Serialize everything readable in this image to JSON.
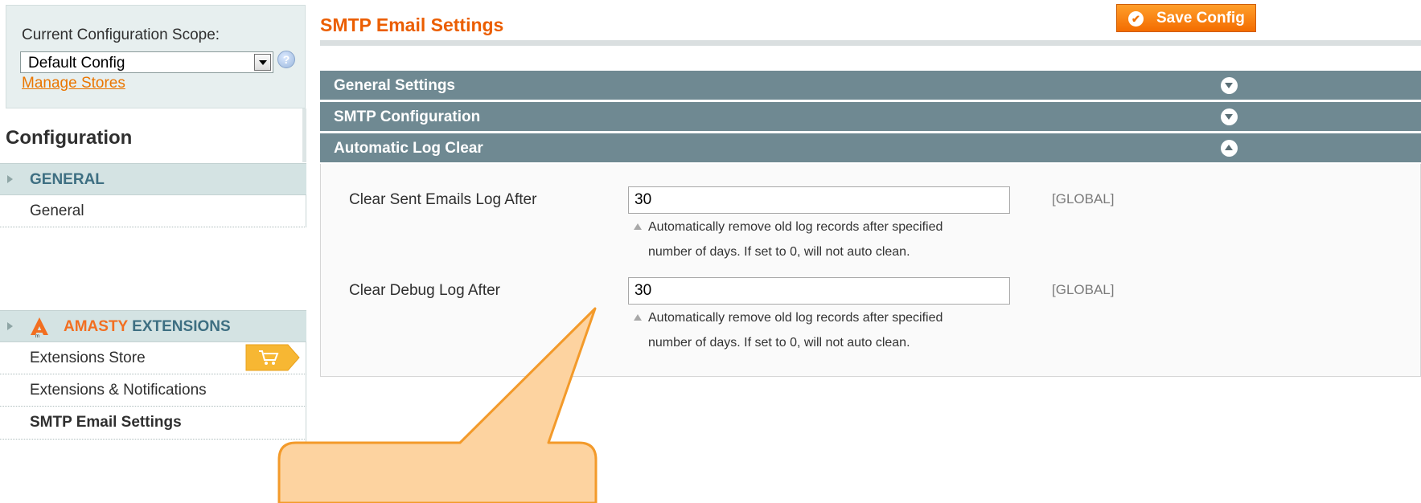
{
  "sidebar": {
    "scope_label": "Current Configuration Scope:",
    "scope_value": "Default Config",
    "manage_stores": "Manage Stores",
    "config_title": "Configuration",
    "groups": [
      {
        "label": "GENERAL",
        "items": [
          "General"
        ]
      },
      {
        "label_prefix": "AMASTY",
        "label_suffix": "EXTENSIONS",
        "items": [
          "Extensions Store",
          "Extensions & Notifications",
          "SMTP Email Settings"
        ]
      }
    ]
  },
  "main": {
    "title": "SMTP Email Settings",
    "save_button": "Save Config",
    "sections": [
      {
        "label": "General Settings",
        "expanded": false
      },
      {
        "label": "SMTP Configuration",
        "expanded": false
      },
      {
        "label": "Automatic Log Clear",
        "expanded": true
      }
    ],
    "fields": [
      {
        "label": "Clear Sent Emails Log After",
        "value": "30",
        "note_line1": "Automatically remove old log records after specified",
        "note_line2": "number of days. If set to 0, will not auto clean.",
        "scope": "[GLOBAL]"
      },
      {
        "label": "Clear Debug Log After",
        "value": "30",
        "note_line1": "Automatically remove old log records after specified",
        "note_line2": "number of days. If set to 0, will not auto clean.",
        "scope": "[GLOBAL]"
      }
    ]
  },
  "colors": {
    "accent": "#eb5e00",
    "section_header": "#6f8992",
    "sidebar_group": "#d4e3e3",
    "callout_fill": "#fdd3a0",
    "callout_stroke": "#f39a2a"
  },
  "icons": [
    "chevron-down-icon",
    "chevron-up-icon",
    "check-icon",
    "help-icon",
    "cart-icon",
    "amasty-logo"
  ]
}
